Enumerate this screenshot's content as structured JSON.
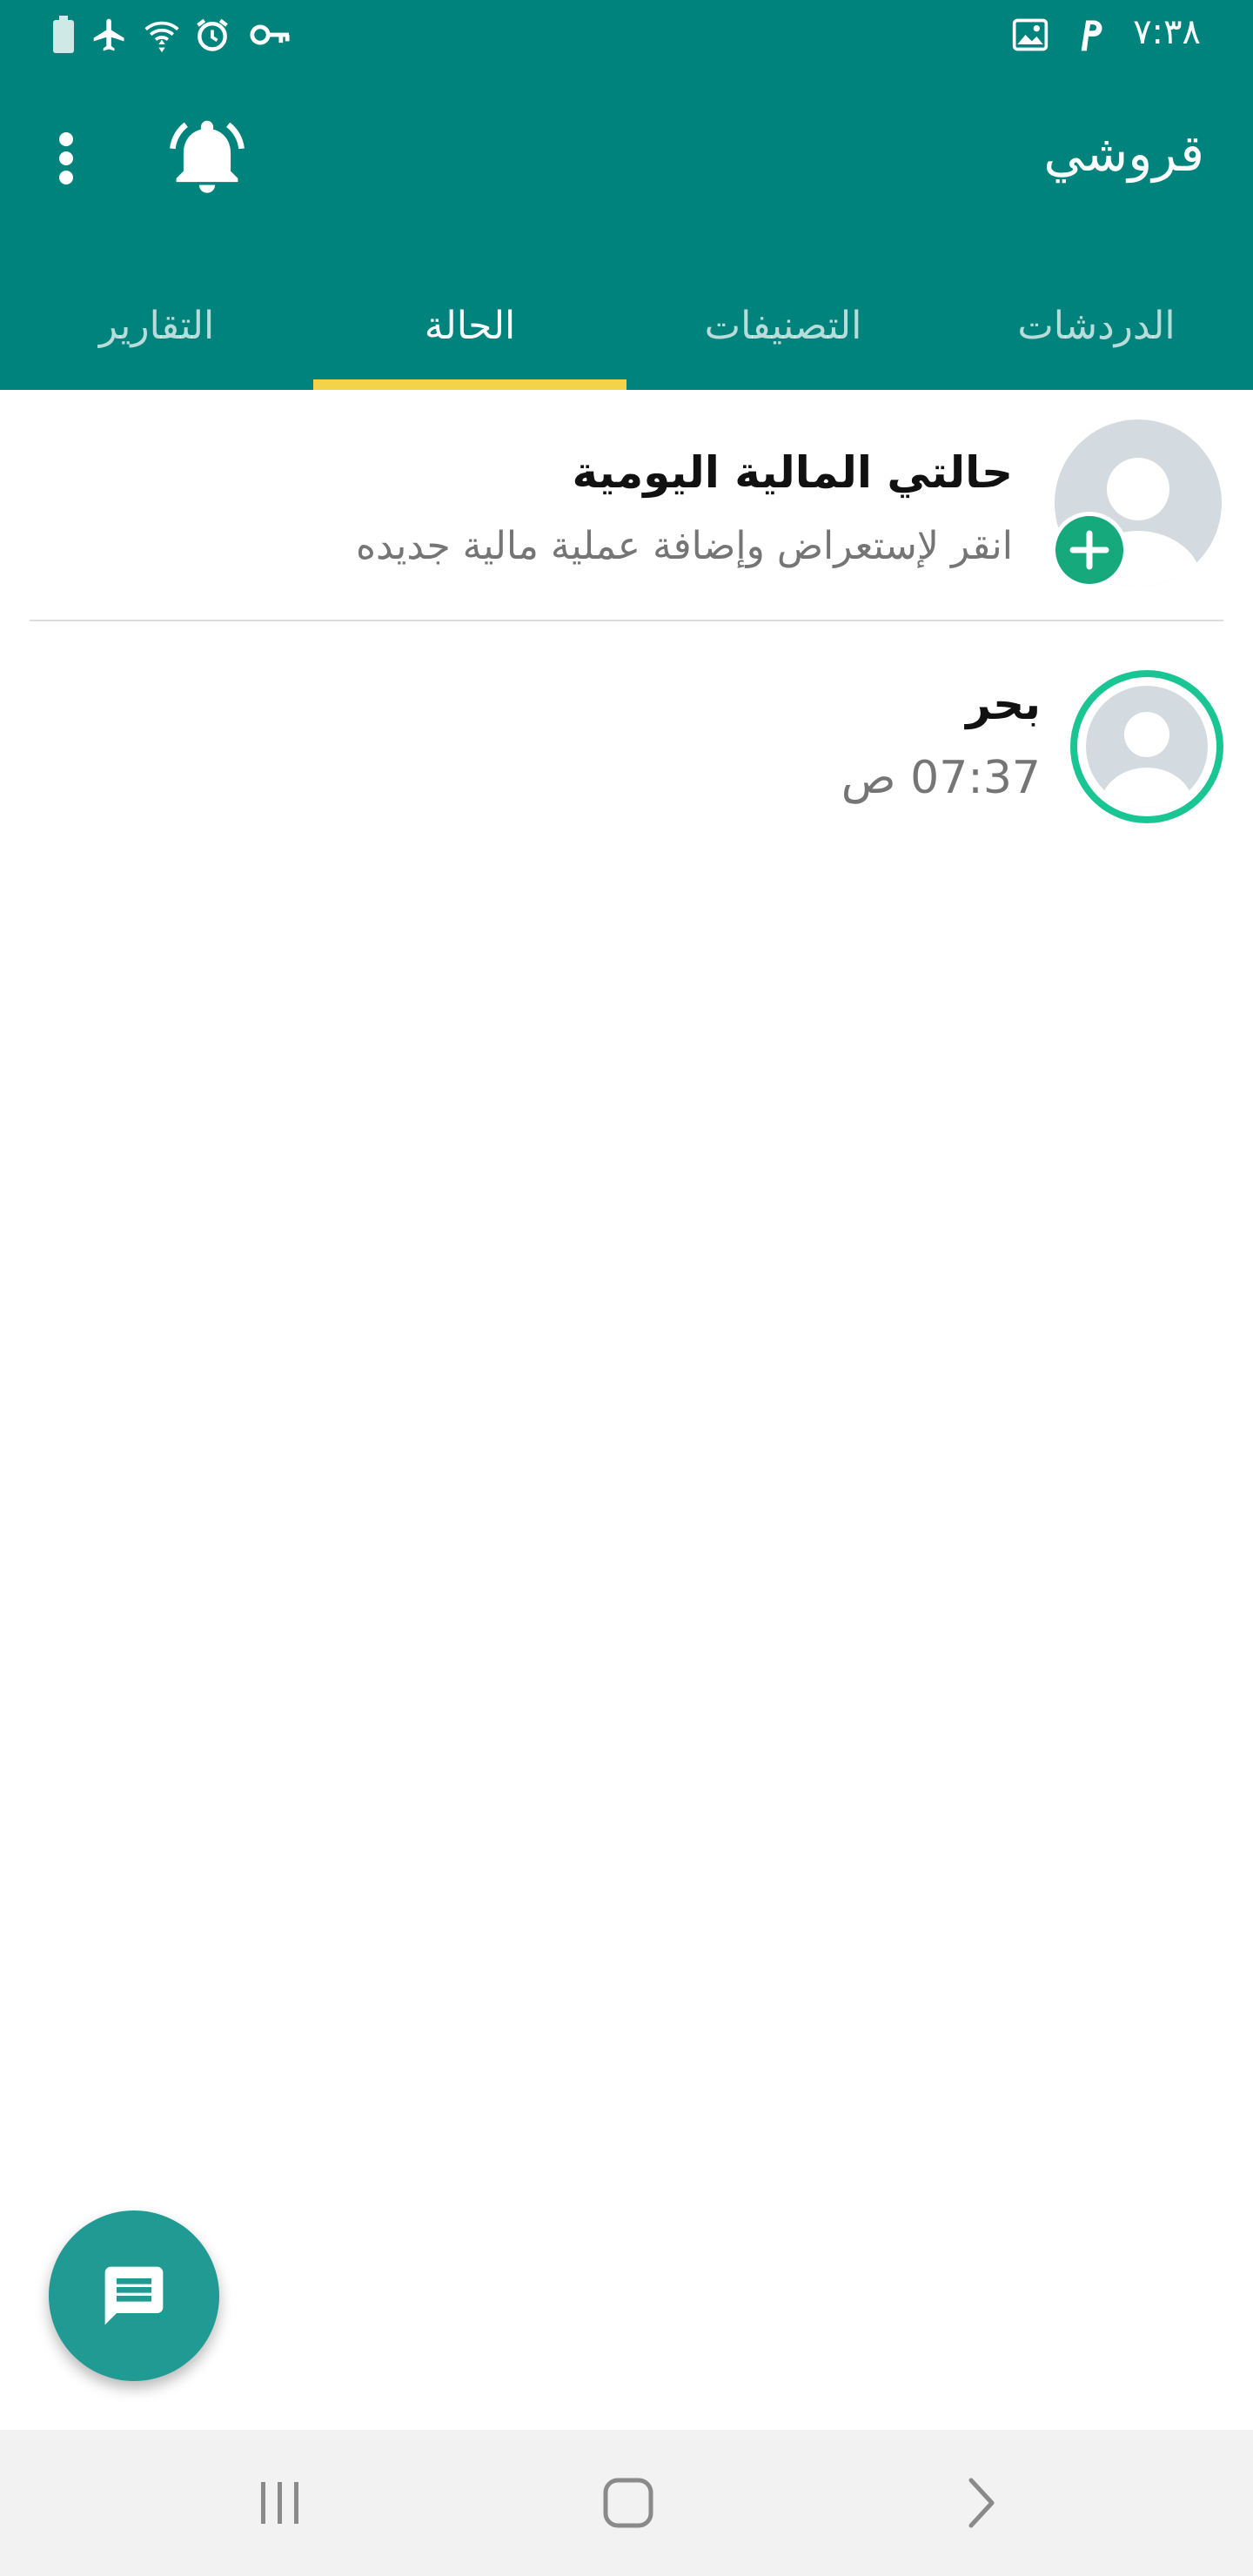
{
  "status_bar": {
    "time": "٧:٣٨",
    "icons_left": [
      "battery-icon",
      "airplane-icon",
      "wifi-icon",
      "alarm-icon",
      "vpn-key-icon"
    ],
    "icons_right": [
      "image-icon",
      "parking-icon"
    ]
  },
  "header": {
    "title": "قروشي",
    "actions": [
      "more-options-icon",
      "bell-ringing-icon"
    ]
  },
  "tabs": [
    {
      "label": "الدردشات",
      "active": false
    },
    {
      "label": "التصنيفات",
      "active": false
    },
    {
      "label": "الحالة",
      "active": true
    },
    {
      "label": "التقارير",
      "active": false
    }
  ],
  "my_status": {
    "title": "حالتي المالية اليومية",
    "subtitle": "انقر لإستعراض وإضافة عملية مالية جديده"
  },
  "status_list": [
    {
      "name": "بحر",
      "time": "07:37 ص"
    }
  ],
  "fab": {
    "icon": "message-icon"
  },
  "nav_bar": {
    "items": [
      "recent-apps-icon",
      "home-icon",
      "back-icon"
    ]
  },
  "colors": {
    "primary": "#00837c",
    "indicator": "#f3d34a",
    "accent_green": "#16a97c",
    "ring": "#19c592",
    "fab": "#229a94"
  }
}
